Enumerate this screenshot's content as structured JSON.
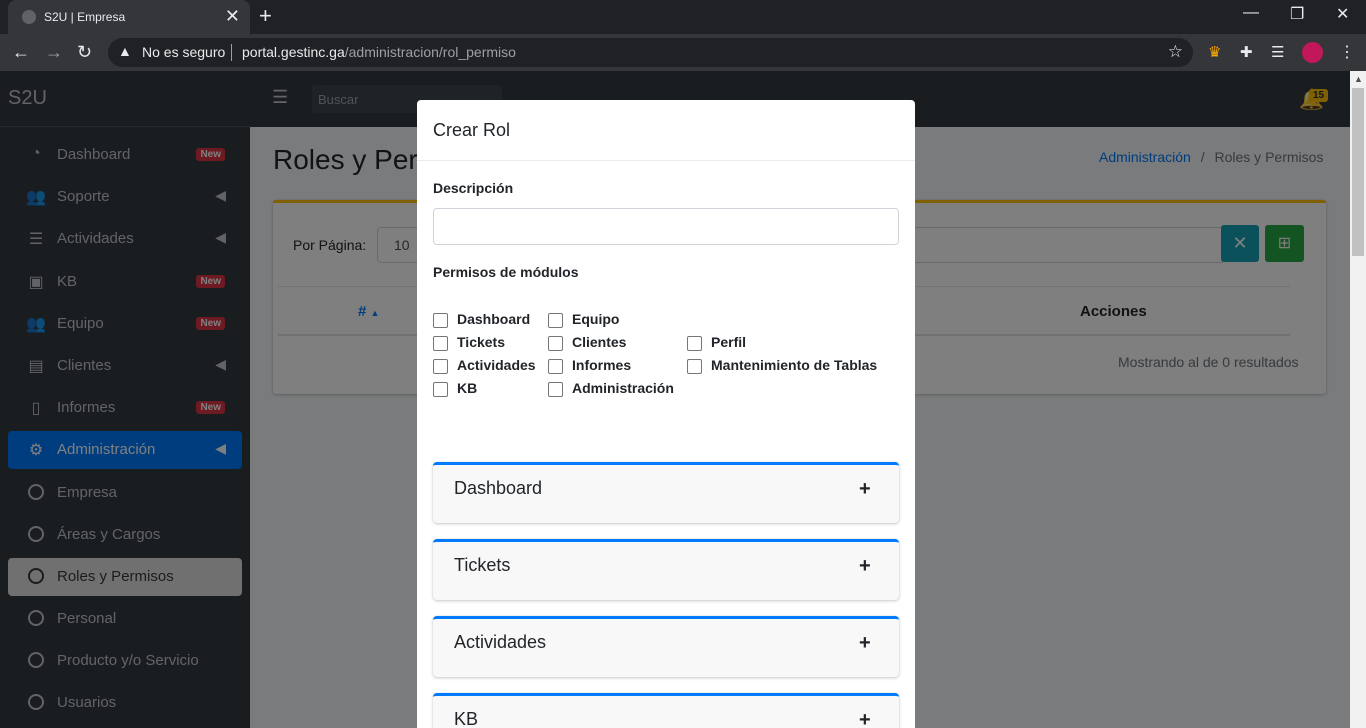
{
  "browser": {
    "tab_title": "S2U | Empresa",
    "tab_close": "✕",
    "new_tab": "+",
    "security": "No es seguro",
    "url_host": "portal.gestinc.ga",
    "url_path": "/administracion/rol_permiso"
  },
  "sidebar": {
    "brand": "S2U",
    "items": [
      {
        "label": "Dashboard",
        "badge": "New"
      },
      {
        "label": "Soporte"
      },
      {
        "label": "Actividades"
      },
      {
        "label": "KB",
        "badge": "New"
      },
      {
        "label": "Equipo",
        "badge": "New"
      },
      {
        "label": "Clientes"
      },
      {
        "label": "Informes",
        "badge": "New"
      },
      {
        "label": "Administración"
      },
      {
        "label": "Empresa"
      },
      {
        "label": "Áreas y Cargos"
      },
      {
        "label": "Roles y Permisos"
      },
      {
        "label": "Personal"
      },
      {
        "label": "Producto y/o Servicio"
      },
      {
        "label": "Usuarios"
      }
    ]
  },
  "topnav": {
    "search_placeholder": "Buscar",
    "notifications": "15"
  },
  "content": {
    "title": "Roles y Per",
    "breadcrumb": {
      "parent": "Administración",
      "sep": "/",
      "current": "Roles y Permisos"
    },
    "per_page_label": "Por Página:",
    "per_page_value": "10",
    "col_hash": "#",
    "col_actions": "Acciones",
    "showing": "Mostrando al de 0 resultados"
  },
  "modal": {
    "title": "Crear Rol",
    "desc_label": "Descripción",
    "perm_label": "Permisos de módulos",
    "checkboxes": [
      "Dashboard",
      "Tickets",
      "Actividades",
      "KB",
      "Equipo",
      "Clientes",
      "Informes",
      "Administración",
      "Perfil",
      "Mantenimiento de Tablas"
    ],
    "accordions": [
      "Dashboard",
      "Tickets",
      "Actividades",
      "KB"
    ],
    "plus": "+"
  }
}
